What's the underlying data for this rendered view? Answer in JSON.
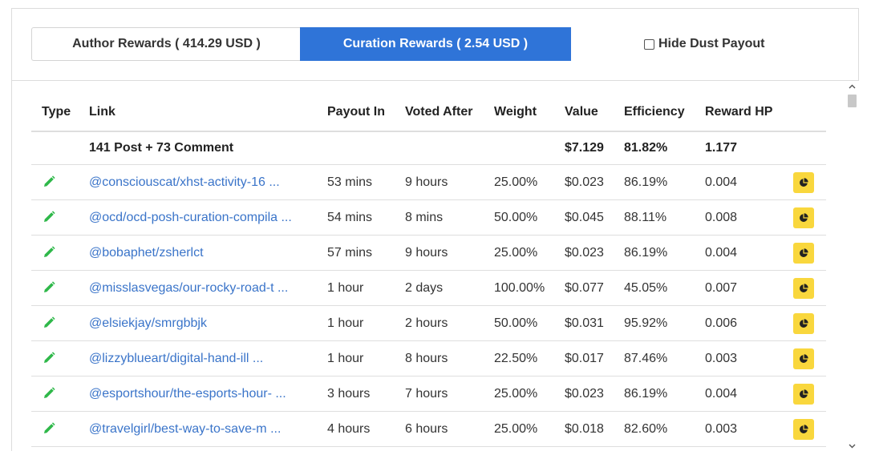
{
  "tabs": {
    "author_label": "Author Rewards ( 414.29 USD )",
    "curation_label": "Curation Rewards ( 2.54 USD )",
    "hide_dust_label": "Hide Dust Payout"
  },
  "columns": {
    "type": "Type",
    "link": "Link",
    "payout_in": "Payout In",
    "voted_after": "Voted After",
    "weight": "Weight",
    "value": "Value",
    "efficiency": "Efficiency",
    "reward_hp": "Reward HP"
  },
  "summary": {
    "label": "141 Post + 73 Comment",
    "value": "$7.129",
    "efficiency": "81.82%",
    "reward_hp": "1.177"
  },
  "rows": [
    {
      "link": "@consciouscat/xhst-activity-16 ...",
      "payout_in": "53 mins",
      "voted_after": "9 hours",
      "weight": "25.00%",
      "value": "$0.023",
      "efficiency": "86.19%",
      "reward_hp": "0.004"
    },
    {
      "link": "@ocd/ocd-posh-curation-compila ...",
      "payout_in": "54 mins",
      "voted_after": "8 mins",
      "weight": "50.00%",
      "value": "$0.045",
      "efficiency": "88.11%",
      "reward_hp": "0.008"
    },
    {
      "link": "@bobaphet/zsherlct",
      "payout_in": "57 mins",
      "voted_after": "9 hours",
      "weight": "25.00%",
      "value": "$0.023",
      "efficiency": "86.19%",
      "reward_hp": "0.004"
    },
    {
      "link": "@misslasvegas/our-rocky-road-t ...",
      "payout_in": "1 hour",
      "voted_after": "2 days",
      "weight": "100.00%",
      "value": "$0.077",
      "efficiency": "45.05%",
      "reward_hp": "0.007"
    },
    {
      "link": "@elsiekjay/smrgbbjk",
      "payout_in": "1 hour",
      "voted_after": "2 hours",
      "weight": "50.00%",
      "value": "$0.031",
      "efficiency": "95.92%",
      "reward_hp": "0.006"
    },
    {
      "link": "@lizzyblueart/digital-hand-ill ...",
      "payout_in": "1 hour",
      "voted_after": "8 hours",
      "weight": "22.50%",
      "value": "$0.017",
      "efficiency": "87.46%",
      "reward_hp": "0.003"
    },
    {
      "link": "@esportshour/the-esports-hour- ...",
      "payout_in": "3 hours",
      "voted_after": "7 hours",
      "weight": "25.00%",
      "value": "$0.023",
      "efficiency": "86.19%",
      "reward_hp": "0.004"
    },
    {
      "link": "@travelgirl/best-way-to-save-m ...",
      "payout_in": "4 hours",
      "voted_after": "6 hours",
      "weight": "25.00%",
      "value": "$0.018",
      "efficiency": "82.60%",
      "reward_hp": "0.003"
    }
  ],
  "icons": {
    "type": "pencil-icon",
    "action": "pie-chart-icon",
    "scroll_up": "chevron-up-icon",
    "scroll_down": "chevron-down-icon"
  },
  "colors": {
    "active_tab": "#2f74d8",
    "link": "#3a74c9",
    "pencil": "#2fb84a",
    "chart_button": "#f9d73d"
  }
}
